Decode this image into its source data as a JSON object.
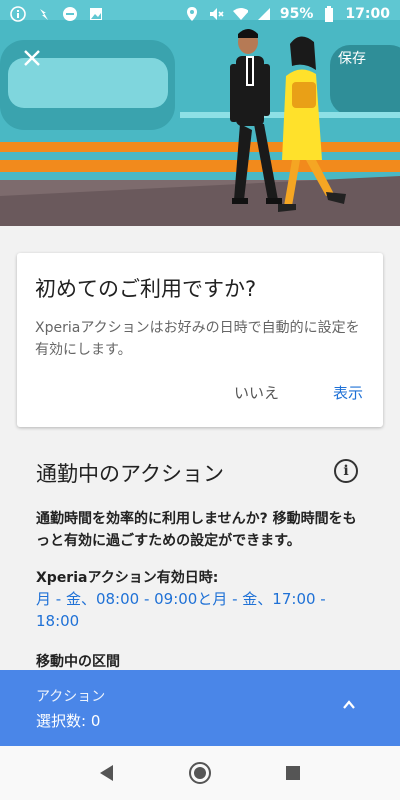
{
  "status_bar": {
    "battery": "95%",
    "time": "17:00",
    "icons": [
      "info-icon",
      "flash-icon",
      "dnd-icon",
      "image-icon",
      "location-icon",
      "mute-icon",
      "wifi-icon",
      "signal-icon",
      "battery-icon"
    ]
  },
  "header": {
    "close_icon": "close-icon",
    "save_label": "保存"
  },
  "card": {
    "title": "初めてのご利用ですか?",
    "body": "Xperiaアクションはお好みの日時で自動的に設定を有効にします。",
    "no_label": "いいえ",
    "show_label": "表示"
  },
  "commute": {
    "title": "通勤中のアクション",
    "description": "通勤時間を効率的に利用しませんか? 移動時間をもっと有効に過ごすための設定ができます。",
    "active_label": "Xperiaアクション有効日時:",
    "schedule": "月 - 金、08:00 - 09:00と月 - 金、17:00 - 18:00",
    "segment_label": "移動中の区間"
  },
  "action_bar": {
    "label": "アクション",
    "count": "選択数: 0"
  },
  "colors": {
    "accent": "#1f71d6",
    "action_bar": "#4a86e8",
    "hero_sky": "#5bc6cf",
    "hero_stripe": "#f28a1c"
  }
}
